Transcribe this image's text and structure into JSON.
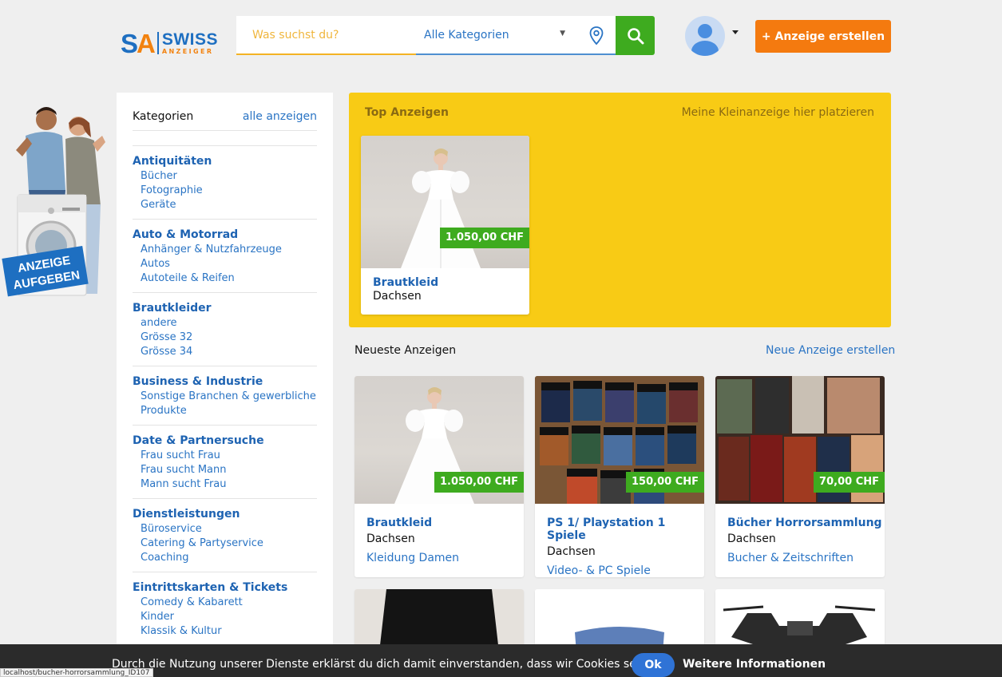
{
  "header": {
    "logo": {
      "sa": "SA",
      "swiss": "SWISS",
      "anzeiger": "ANZEIGER"
    },
    "search_placeholder": "Was suchst du?",
    "category_select": "Alle Kategorien",
    "create_button": "+ Anzeige erstellen"
  },
  "promo": {
    "line1": "ANZEIGE",
    "line2": "AUFGEBEN"
  },
  "sidebar": {
    "title": "Kategorien",
    "show_all": "alle anzeigen",
    "groups": [
      {
        "name": "Antiquitäten",
        "subs": [
          "Bücher",
          "Fotographie",
          "Geräte"
        ]
      },
      {
        "name": "Auto & Motorrad",
        "subs": [
          "Anhänger & Nutzfahrzeuge",
          "Autos",
          "Autoteile & Reifen"
        ]
      },
      {
        "name": "Brautkleider",
        "subs": [
          "andere",
          "Grösse 32",
          "Grösse 34"
        ]
      },
      {
        "name": "Business & Industrie",
        "subs": [
          "Sonstige Branchen & gewerbliche Produkte"
        ]
      },
      {
        "name": "Date & Partnersuche",
        "subs": [
          "Frau sucht Frau",
          "Frau sucht Mann",
          "Mann sucht Frau"
        ]
      },
      {
        "name": "Dienstleistungen",
        "subs": [
          "Büroservice",
          "Catering & Partyservice",
          "Coaching"
        ]
      },
      {
        "name": "Eintrittskarten & Tickets",
        "subs": [
          "Comedy & Kabarett",
          "Kinder",
          "Klassik & Kultur"
        ]
      }
    ]
  },
  "top_ads": {
    "title": "Top Anzeigen",
    "place_link": "Meine Kleinanzeige hier platzieren",
    "items": [
      {
        "title": "Brautkleid",
        "location": "Dachsen",
        "price": "1.050,00 CHF"
      }
    ]
  },
  "newest": {
    "title": "Neueste Anzeigen",
    "create_link": "Neue Anzeige erstellen",
    "items": [
      {
        "title": "Brautkleid",
        "location": "Dachsen",
        "category": "Kleidung Damen",
        "price": "1.050,00 CHF"
      },
      {
        "title": "PS 1/ Playstation 1 Spiele",
        "location": "Dachsen",
        "category": "Video- & PC Spiele",
        "price": "150,00 CHF"
      },
      {
        "title": "Bücher Horrorsammlung",
        "location": "Dachsen",
        "category": "Bucher & Zeitschriften",
        "price": "70,00 CHF"
      }
    ]
  },
  "cookie": {
    "message": "Durch die Nutzung unserer Dienste erklärst du dich damit einverstanden, dass wir Cookies setzen.",
    "ok": "Ok",
    "more": "Weitere Informationen"
  },
  "status_bar": "localhost/bucher-horrorsammlung_ID107",
  "colors": {
    "brand_blue": "#1e6fc1",
    "brand_orange": "#f47a0f",
    "price_green": "#3eab1f",
    "top_yellow": "#f8cb15"
  }
}
